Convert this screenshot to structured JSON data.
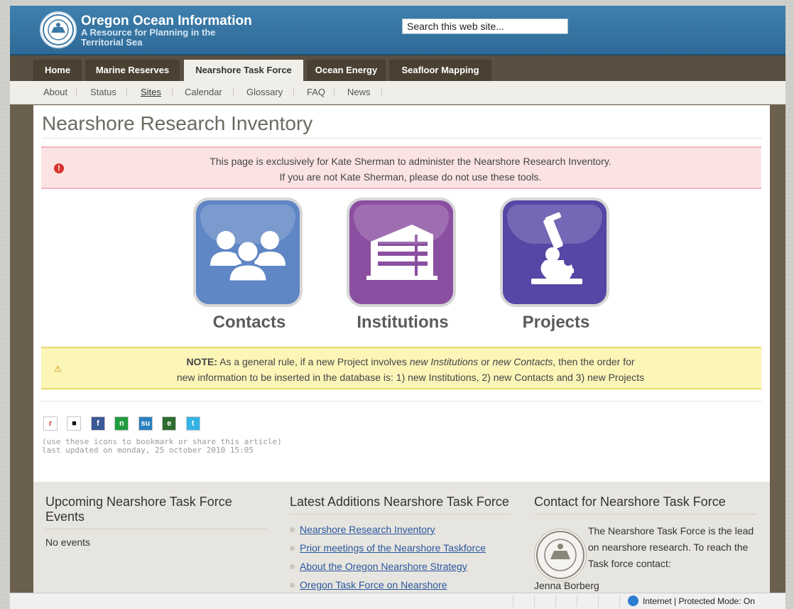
{
  "header": {
    "site_title": "Oregon Ocean Information",
    "site_subtitle": "A Resource for Planning in the Territorial Sea",
    "search_value": "Search this web site..."
  },
  "nav": {
    "tabs": [
      {
        "label": "Home"
      },
      {
        "label": "Marine Reserves"
      },
      {
        "label": "Nearshore Task Force"
      },
      {
        "label": "Ocean Energy"
      },
      {
        "label": "Seafloor Mapping"
      }
    ],
    "active_tab": "Nearshore Task Force"
  },
  "subnav": {
    "items": [
      "About",
      "Status",
      "Sites",
      "Calendar",
      "Glossary",
      "FAQ",
      "News"
    ],
    "active_item": "Sites"
  },
  "page": {
    "title": "Nearshore Research Inventory",
    "alert_line1": "This page is exclusively for Kate Sherman to administer the Nearshore Research Inventory.",
    "alert_line2": "If you are not Kate Sherman, please do not use these tools.",
    "tiles": [
      {
        "label": "Contacts",
        "color": "#5f86c5",
        "icon": "people-icon"
      },
      {
        "label": "Institutions",
        "color": "#8a4fa0",
        "icon": "building-icon"
      },
      {
        "label": "Projects",
        "color": "#5547a5",
        "icon": "microscope-icon"
      }
    ],
    "note_label": "NOTE:",
    "note_1": " As a general rule, if a new Project involves ",
    "note_em1": "new Institutions",
    "note_2": " or ",
    "note_em2": "new Contacts",
    "note_3": ", then the order for",
    "note_line2": "new information to be inserted in the database is: 1) new Institutions, 2) new Contacts and 3) new Projects",
    "share_icons": [
      "reddit-icon",
      "delicious-icon",
      "facebook-icon",
      "newsvine-icon",
      "stumbleupon-icon",
      "evernote-icon",
      "technorati-icon"
    ],
    "share_hint": "(use these icons to bookmark or share this article)",
    "last_updated": "last updated on monday, 25 october 2010 15:05"
  },
  "footer": {
    "events_title": "Upcoming Nearshore Task Force Events",
    "events_empty": "No events",
    "latest_title": "Latest Additions Nearshore Task Force",
    "latest_links": [
      "Nearshore Research Inventory",
      "Prior meetings of the Nearshore Taskforce",
      "About the Oregon Nearshore Strategy",
      "Oregon Task Force on Nearshore"
    ],
    "contact_title": "Contact for Nearshore Task Force",
    "contact_text": "The Nearshore Task Force is the lead on nearshore research. To reach the Task force contact:",
    "contact_name": "Jenna Borberg"
  },
  "statusbar": {
    "zone_text": "Internet | Protected Mode: On"
  },
  "colors": {
    "header_blue": "#3a78a6",
    "nav_brown": "#5a4f40",
    "alert_bg": "#fbe3e4",
    "note_bg": "#fbf5b8"
  }
}
